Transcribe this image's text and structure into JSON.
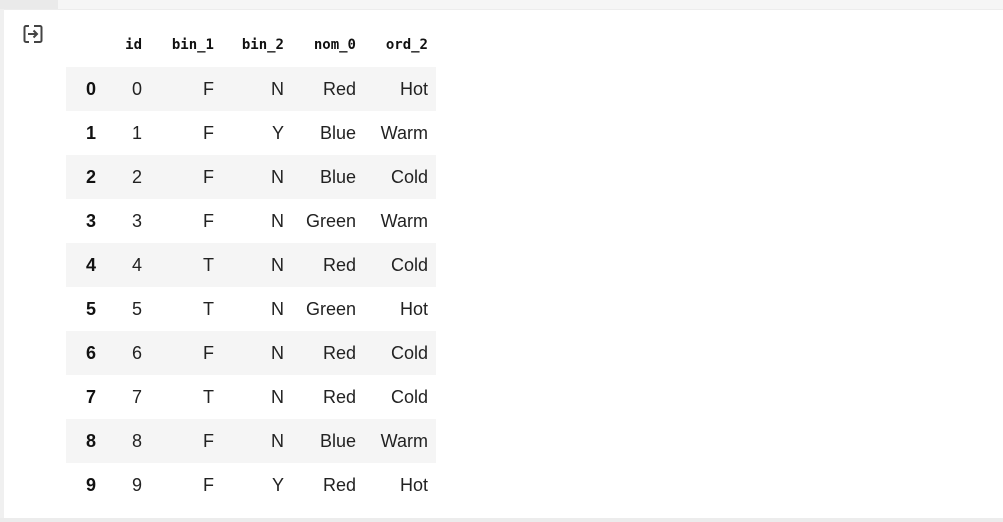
{
  "output": {
    "icon": "output-icon"
  },
  "table": {
    "columns": [
      "id",
      "bin_1",
      "bin_2",
      "nom_0",
      "ord_2"
    ],
    "rows": [
      {
        "index": "0",
        "cells": [
          "0",
          "F",
          "N",
          "Red",
          "Hot"
        ]
      },
      {
        "index": "1",
        "cells": [
          "1",
          "F",
          "Y",
          "Blue",
          "Warm"
        ]
      },
      {
        "index": "2",
        "cells": [
          "2",
          "F",
          "N",
          "Blue",
          "Cold"
        ]
      },
      {
        "index": "3",
        "cells": [
          "3",
          "F",
          "N",
          "Green",
          "Warm"
        ]
      },
      {
        "index": "4",
        "cells": [
          "4",
          "T",
          "N",
          "Red",
          "Cold"
        ]
      },
      {
        "index": "5",
        "cells": [
          "5",
          "T",
          "N",
          "Green",
          "Hot"
        ]
      },
      {
        "index": "6",
        "cells": [
          "6",
          "F",
          "N",
          "Red",
          "Cold"
        ]
      },
      {
        "index": "7",
        "cells": [
          "7",
          "T",
          "N",
          "Red",
          "Cold"
        ]
      },
      {
        "index": "8",
        "cells": [
          "8",
          "F",
          "N",
          "Blue",
          "Warm"
        ]
      },
      {
        "index": "9",
        "cells": [
          "9",
          "F",
          "Y",
          "Red",
          "Hot"
        ]
      }
    ]
  }
}
